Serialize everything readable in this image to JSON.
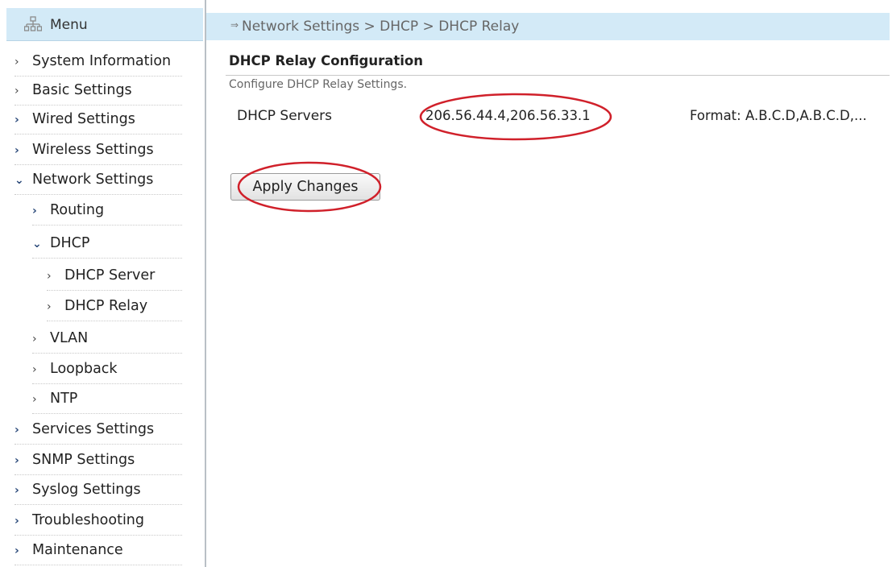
{
  "sidebar": {
    "menu_label": "Menu",
    "items": [
      {
        "label": "System Information"
      },
      {
        "label": "Basic Settings"
      },
      {
        "label": "Wired Settings"
      },
      {
        "label": "Wireless Settings"
      },
      {
        "label": "Network Settings",
        "expanded": true
      },
      {
        "label": "Routing"
      },
      {
        "label": "DHCP",
        "expanded": true
      },
      {
        "label": "DHCP Server"
      },
      {
        "label": "DHCP Relay",
        "selected": true
      },
      {
        "label": "VLAN"
      },
      {
        "label": "Loopback"
      },
      {
        "label": "NTP"
      },
      {
        "label": "Services Settings"
      },
      {
        "label": "SNMP Settings"
      },
      {
        "label": "Syslog Settings"
      },
      {
        "label": "Troubleshooting"
      },
      {
        "label": "Maintenance"
      }
    ]
  },
  "breadcrumb": {
    "arrow": "⇒",
    "text": "Network Settings > DHCP > DHCP Relay"
  },
  "main": {
    "title": "DHCP Relay Configuration",
    "description": "Configure DHCP Relay Settings.",
    "dhcp_servers_label": "DHCP Servers",
    "dhcp_servers_value": "206.56.44.4,206.56.33.1",
    "format_hint": "Format: A.B.C.D,A.B.C.D,...",
    "apply_label": "Apply Changes"
  },
  "colors": {
    "header_bg": "#d3eaf7",
    "annotation_red": "#d0202a"
  }
}
